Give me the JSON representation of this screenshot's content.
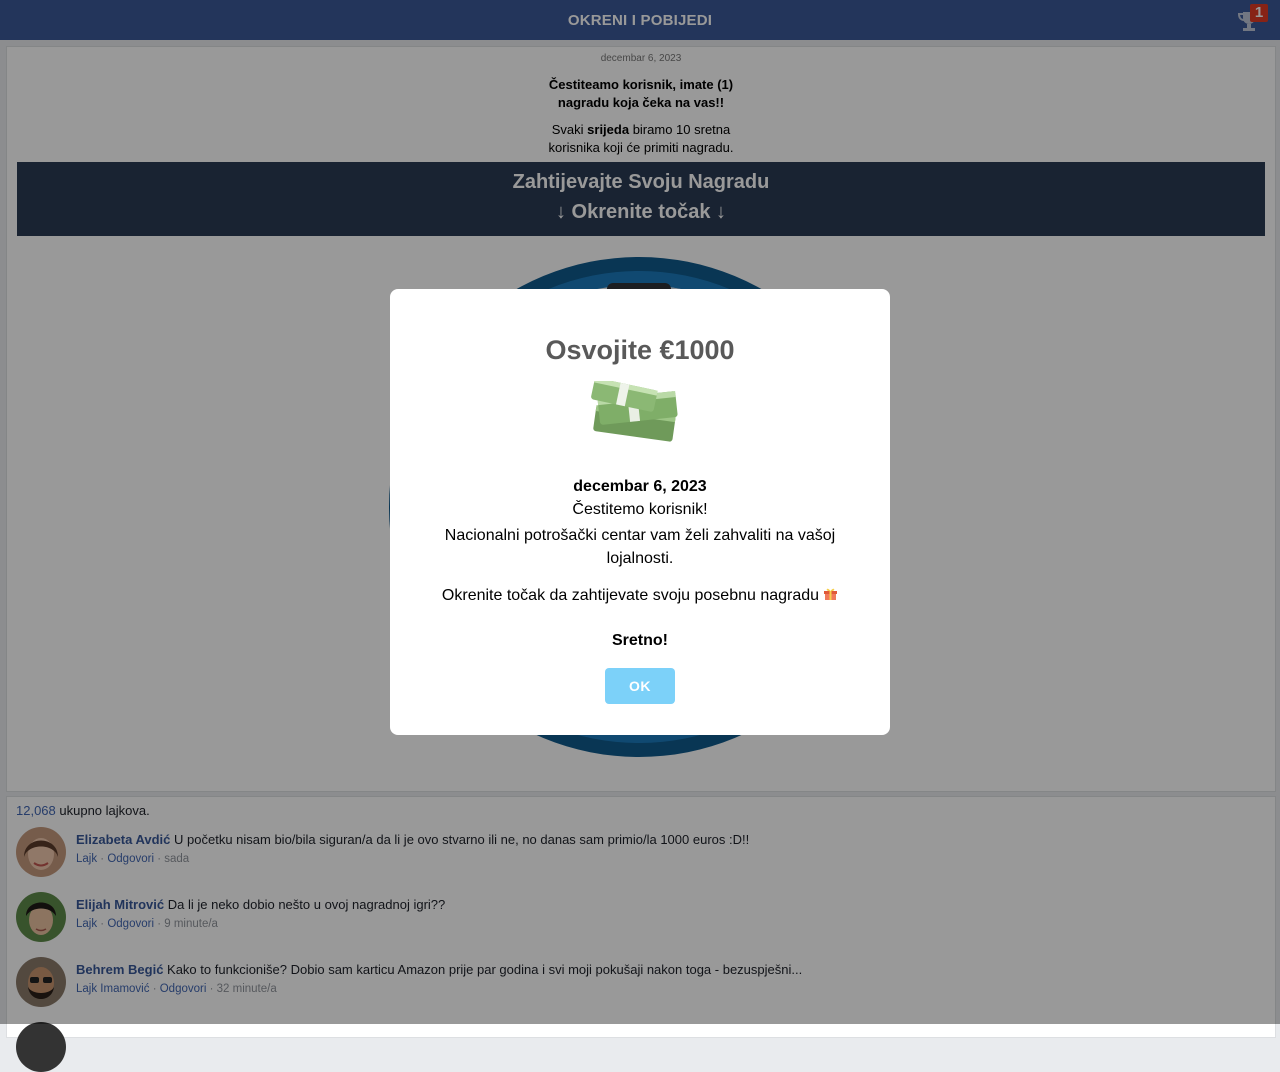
{
  "header": {
    "title": "OKRENI I POBIJEDI",
    "badge_count": "1"
  },
  "main": {
    "date_small": "decembar 6, 2023",
    "congrats_line1": "Čestiteamo korisnik, imate (1)",
    "congrats_line2": "nagradu koja čeka na vas!!",
    "weekly_pre": "Svaki ",
    "weekly_bold": "srijeda",
    "weekly_post": " biramo 10 sretna",
    "weekly_line2": "korisnika koji će primiti nagradu.",
    "banner_line1": "Zahtijevajte Svoju Nagradu",
    "banner_line2": "↓ Okrenite točak ↓"
  },
  "comments": {
    "likes_count": "12,068",
    "likes_suffix": " ukupno lajkova.",
    "items": [
      {
        "name": "Elizabeta Avdić",
        "text": " U početku nisam bio/bila siguran/a da li je ovo stvarno ili ne, no danas sam primio/la 1000 euros :D!!",
        "meta_prefix": "",
        "like": "Lajk",
        "reply": "Odgovori",
        "time": "sada"
      },
      {
        "name": "Elijah Mitrović",
        "text": " Da li je neko dobio nešto u ovoj nagradnoj igri??",
        "meta_prefix": "",
        "like": "Lajk",
        "reply": "Odgovori",
        "time": "9 minute/a"
      },
      {
        "name": "Behrem Begić",
        "text": " Kako to funkcioniše? Dobio sam karticu Amazon prije par godina i svi moji pokušaji nakon toga - bezuspješni...",
        "meta_prefix": "",
        "like": "Lajk Imamović",
        "reply": "Odgovori",
        "time": "32 minute/a"
      }
    ]
  },
  "modal": {
    "title": "Osvojite €1000",
    "date": "decembar 6, 2023",
    "congrats": "Čestitemo korisnik!",
    "thanks": "Nacionalni potrošački centar vam želi zahvaliti na vašoj lojalnosti.",
    "spin": "Okrenite točak da zahtijevate svoju posebnu nagradu",
    "luck": "Sretno!",
    "ok_label": "OK"
  },
  "colors": {
    "header_bg": "#3b5998",
    "banner_bg": "#2a3b54",
    "ok_button": "#7cd1f9",
    "link": "#385898"
  }
}
